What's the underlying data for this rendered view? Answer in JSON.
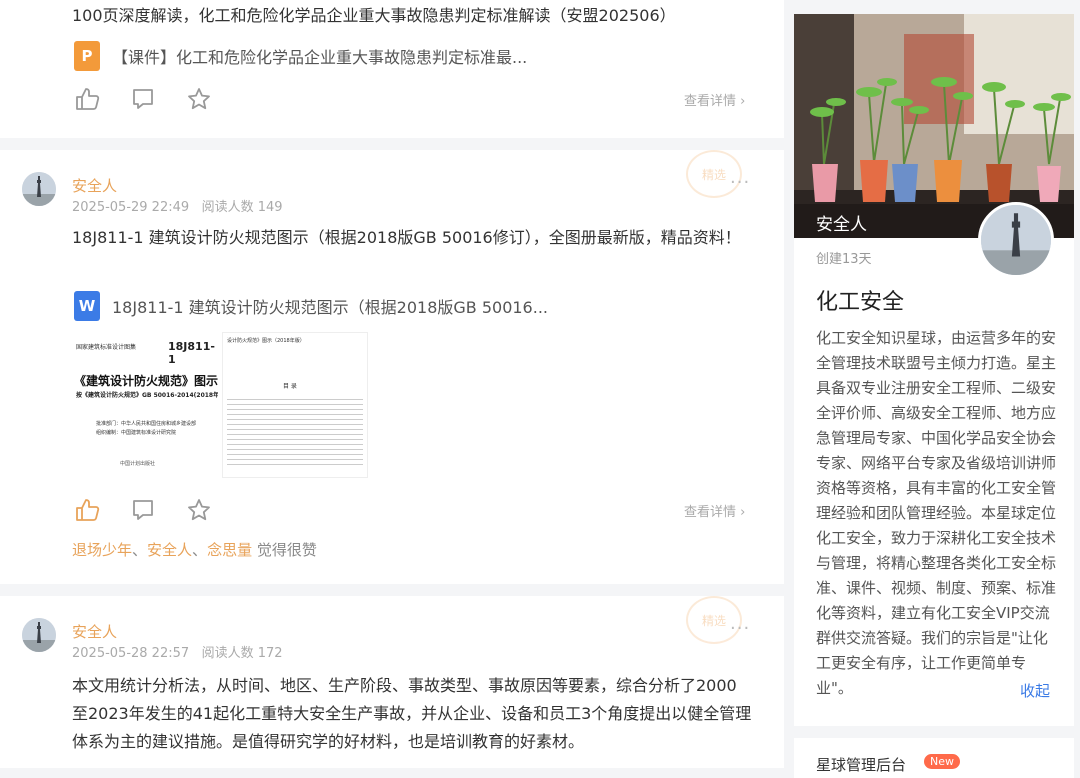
{
  "post1": {
    "text": "100页深度解读，化工和危险化学品企业重大事故隐患判定标准解读（安盟202506）",
    "attachment": "【课件】化工和危险化学品企业重大事故隐患判定标准最...",
    "file_icon_letter": "P",
    "detail": "查看详情"
  },
  "post2": {
    "author": "安全人",
    "time": "2025-05-29 22:49",
    "reads": "阅读人数 149",
    "more": "···",
    "text": "18J811-1 建筑设计防火规范图示（根据2018版GB 50016修订），全图册最新版，精品资料！",
    "attachment": "18J811-1 建筑设计防火规范图示（根据2018版GB 50016...",
    "file_icon_letter": "W",
    "detail": "查看详情",
    "likes": [
      {
        "name": "退场少年"
      },
      {
        "name": "安全人"
      },
      {
        "name": "念思量"
      }
    ],
    "likes_suffix": "觉得很赞",
    "sep": "、",
    "stamp": "精选",
    "thumb1": {
      "header": "国家建筑标准设计图集",
      "code": "18J811-1",
      "title": "《建筑设计防火规范》图示",
      "sub": "按《建筑设计防火规范》GB 50016-2014(2018年版)编制",
      "org1": "批准部门：中华人民共和国住房和城乡建设部",
      "org2": "组织编制：中国建筑标准设计研究院",
      "footer": "中国计划出版社"
    },
    "thumb2": {
      "header": "设计防火规范》图示（2018年版）",
      "toc": "目 录"
    }
  },
  "post3": {
    "author": "安全人",
    "time": "2025-05-28 22:57",
    "reads": "阅读人数 172",
    "more": "···",
    "text": "本文用统计分析法，从时间、地区、生产阶段、事故类型、事故原因等要素，综合分析了2000至2023年发生的41起化工重特大安全生产事故，并从企业、设备和员工3个角度提出以健全管理体系为主的建议措施。是值得研究学的好材料，也是培训教育的好素材。",
    "stamp": "精选"
  },
  "sidebar": {
    "owner": "安全人",
    "created": "创建13天",
    "title": "化工安全",
    "description": "化工安全知识星球，由运营多年的安全管理技术联盟号主倾力打造。星主具备双专业注册安全工程师、二级安全评价师、高级安全工程师、地方应急管理局专家、中国化学品安全协会专家、网络平台专家及省级培训讲师资格等资格，具有丰富的化工安全管理经验和团队管理经验。本星球定位化工安全，致力于深耕化工安全技术与管理，将精心整理各类化工安全标准、课件、视频、制度、预案、标准化等资料，建立有化工安全VIP交流群供交流答疑。我们的宗旨是\"让化工更安全有序，让工作更简单专业\"。",
    "collapse": "收起",
    "manage": "星球管理后台",
    "badge": "New"
  },
  "colors": {
    "accent": "#e8a35a",
    "link": "#3b7be6",
    "ppt": "#f39a3a",
    "word": "#3b7be6"
  }
}
